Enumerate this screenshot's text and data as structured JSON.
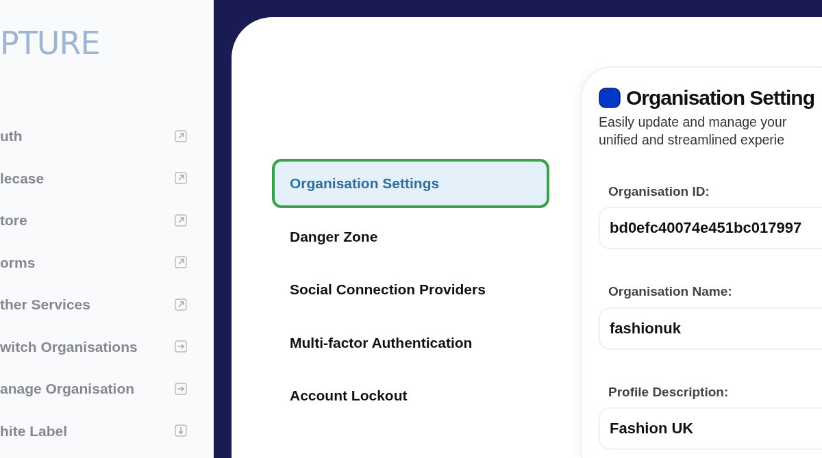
{
  "sidebar": {
    "logo": "PTURE",
    "items": [
      {
        "label": "uth",
        "kind": "external"
      },
      {
        "label": "lecase",
        "kind": "external"
      },
      {
        "label": "tore",
        "kind": "external"
      },
      {
        "label": "orms",
        "kind": "external"
      },
      {
        "label": "ther Services",
        "kind": "external"
      },
      {
        "label": "witch Organisations",
        "kind": "enter"
      },
      {
        "label": "anage Organisation",
        "kind": "enter"
      },
      {
        "label": "hite Label",
        "kind": "download"
      }
    ]
  },
  "settings_nav": [
    {
      "label": "Organisation Settings",
      "selected": true
    },
    {
      "label": "Danger Zone",
      "selected": false
    },
    {
      "label": "Social Connection Providers",
      "selected": false
    },
    {
      "label": "Multi-factor Authentication",
      "selected": false
    },
    {
      "label": "Account Lockout",
      "selected": false
    }
  ],
  "card": {
    "title": "Organisation Setting",
    "description": [
      "Easily update and manage your",
      "unified and streamlined experie"
    ],
    "fields": [
      {
        "label": "Organisation ID:",
        "value": "bd0efc40074e451bc017997"
      },
      {
        "label": "Organisation Name:",
        "value": "fashionuk"
      },
      {
        "label": "Profile Description:",
        "value": "Fashion UK"
      }
    ]
  }
}
